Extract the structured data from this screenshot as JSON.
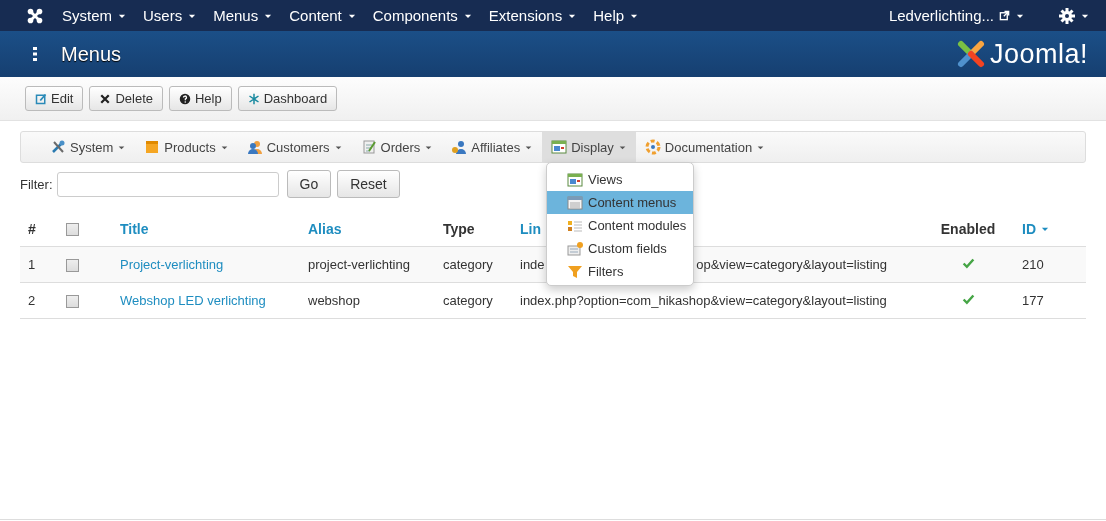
{
  "top_menu": {
    "items": [
      {
        "label": "System"
      },
      {
        "label": "Users"
      },
      {
        "label": "Menus"
      },
      {
        "label": "Content"
      },
      {
        "label": "Components"
      },
      {
        "label": "Extensions"
      },
      {
        "label": "Help"
      }
    ],
    "site_link": "Ledverlichting..."
  },
  "header": {
    "title": "Menus",
    "logo_text": "Joomla!"
  },
  "toolbar": [
    {
      "label": "Edit",
      "kind": "edit"
    },
    {
      "label": "Delete",
      "kind": "delete"
    },
    {
      "label": "Help",
      "kind": "help"
    },
    {
      "label": "Dashboard",
      "kind": "dashboard"
    }
  ],
  "sub_menu": [
    {
      "label": "System",
      "kind": "tools",
      "selected": false
    },
    {
      "label": "Products",
      "kind": "box",
      "selected": false
    },
    {
      "label": "Customers",
      "kind": "people",
      "selected": false
    },
    {
      "label": "Orders",
      "kind": "orders",
      "selected": false
    },
    {
      "label": "Affiliates",
      "kind": "affiliates",
      "selected": false
    },
    {
      "label": "Display",
      "kind": "display",
      "selected": true
    },
    {
      "label": "Documentation",
      "kind": "lifebuoy",
      "selected": false
    }
  ],
  "dropdown": [
    {
      "label": "Views",
      "kind": "display",
      "selected": false
    },
    {
      "label": "Content menus",
      "kind": "menus",
      "selected": true
    },
    {
      "label": "Content modules",
      "kind": "modules",
      "selected": false
    },
    {
      "label": "Custom fields",
      "kind": "fields",
      "selected": false
    },
    {
      "label": "Filters",
      "kind": "filter",
      "selected": false
    }
  ],
  "filter": {
    "label": "Filter:",
    "go": "Go",
    "reset": "Reset"
  },
  "table": {
    "columns": [
      {
        "label": "#",
        "kind": "plain"
      },
      {
        "kind": "checkbox",
        "checked": false
      },
      {
        "label": "Title",
        "kind": "link"
      },
      {
        "label": "Alias",
        "kind": "link"
      },
      {
        "label": "Type",
        "kind": "plain"
      },
      {
        "label": "Lin",
        "kind": "link"
      },
      {
        "label": "Enabled",
        "kind": "plain"
      },
      {
        "label": "ID",
        "kind": "sort"
      }
    ],
    "rows": [
      {
        "num": "1",
        "checked": false,
        "title": "Project-verlichting",
        "alias": "project-verlichting",
        "type": "category",
        "link_start": "inde",
        "link_end": "op&view=category&layout=listing",
        "enabled": true,
        "id": "210"
      },
      {
        "num": "2",
        "checked": false,
        "title": "Webshop LED verlichting",
        "alias": "webshop",
        "type": "category",
        "link_start": "index.php?option=com_hikashop&view=category&layout=listing",
        "enabled": true,
        "id": "177"
      }
    ]
  }
}
